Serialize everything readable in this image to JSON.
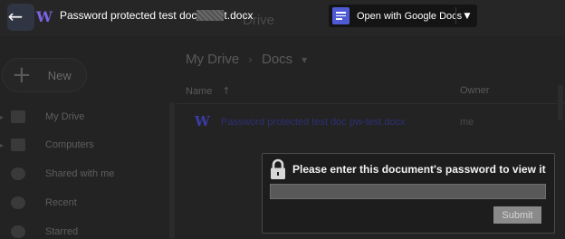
{
  "viewer": {
    "doc_title_prefix": "Password protected test doc",
    "doc_title_suffix": "t.docx",
    "doc_badge": "W",
    "open_with_label": "Open with Google Docs"
  },
  "drive": {
    "app_title": "Drive",
    "new_label": "New",
    "sidebar": [
      {
        "label": "My Drive",
        "icon": "drive-icon"
      },
      {
        "label": "Computers",
        "icon": "computer-icon"
      },
      {
        "label": "Shared with me",
        "icon": "people-icon"
      },
      {
        "label": "Recent",
        "icon": "clock-icon"
      },
      {
        "label": "Starred",
        "icon": "star-icon"
      }
    ],
    "breadcrumb": [
      "My Drive",
      "Docs"
    ],
    "columns": {
      "name": "Name",
      "owner": "Owner"
    },
    "files": [
      {
        "name": "Password protected test doc pw-test.docx",
        "owner": "me",
        "icon": "W"
      }
    ]
  },
  "password_dialog": {
    "prompt": "Please enter this document's password to view it",
    "input_value": "",
    "submit_label": "Submit"
  },
  "colors": {
    "accent": "#4f5bd5",
    "word_icon": "#7a63e6"
  }
}
